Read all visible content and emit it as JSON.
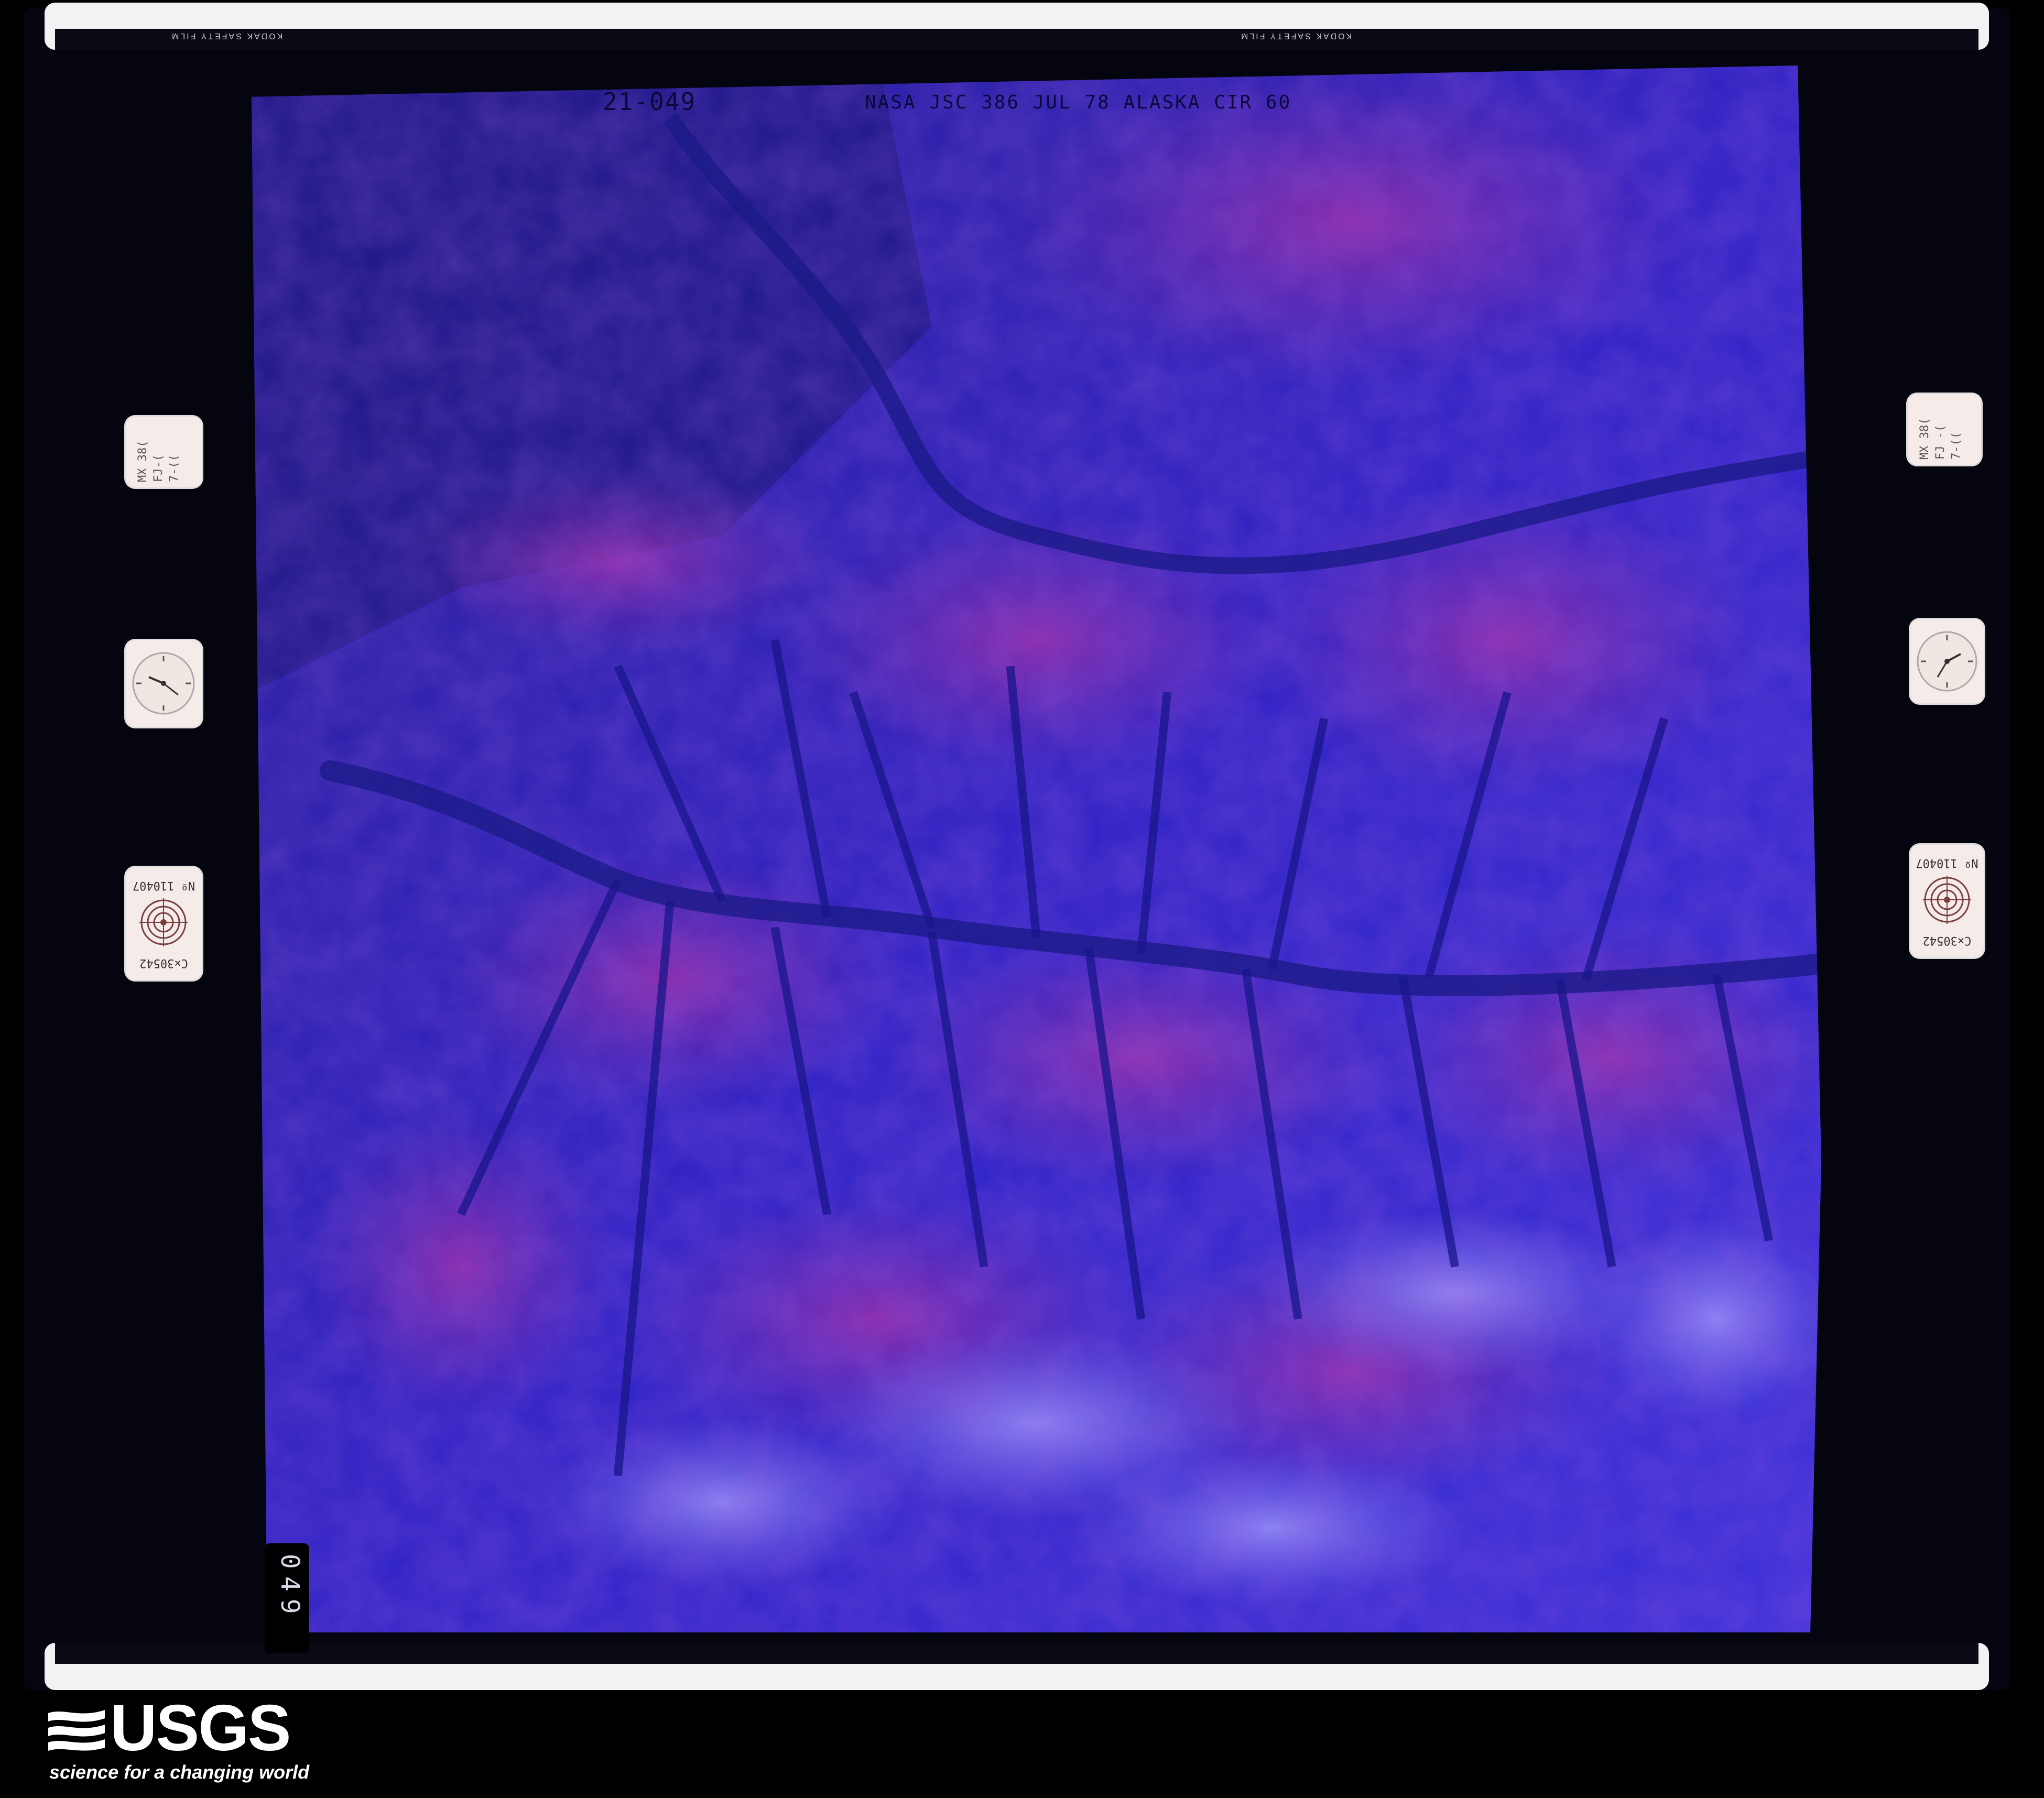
{
  "film": {
    "edge_label_1": "KODAK SAFETY FILM",
    "edge_label_2": "KODAK SAFETY FILM"
  },
  "photo": {
    "frame_id": "21-049",
    "mission_text": "NASA JSC 386 JUL 78 ALASKA CIR 60",
    "frame_number": "049"
  },
  "data_blocks": {
    "left_note": [
      "MX 38(",
      "FJ-(",
      "7-(("
    ],
    "right_note": [
      "MX 38(",
      "FJ -(",
      "7-(("
    ],
    "target_serial": "Nº 110407",
    "target_code": "C×30542"
  },
  "logo": {
    "wordmark": "USGS",
    "tagline": "science for a changing world"
  },
  "colors": {
    "photo_base": "#2a1fb0",
    "photo_magenta": "#8a2aa0",
    "photo_highlight": "#8f86ff",
    "film_base": "#050510"
  }
}
